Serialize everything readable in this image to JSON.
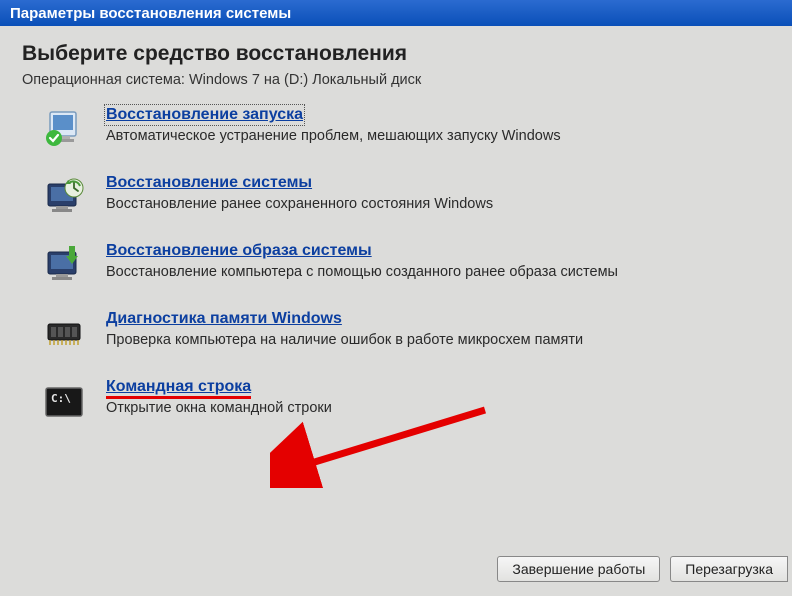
{
  "titlebar": "Параметры восстановления системы",
  "heading": "Выберите средство восстановления",
  "subheading": "Операционная система: Windows 7 на (D:) Локальный диск",
  "options": [
    {
      "link": "Восстановление запуска",
      "desc": "Автоматическое устранение проблем, мешающих запуску Windows"
    },
    {
      "link": "Восстановление системы",
      "desc": "Восстановление ранее сохраненного состояния Windows"
    },
    {
      "link": "Восстановление образа системы",
      "desc": "Восстановление компьютера с помощью  созданного ранее образа системы"
    },
    {
      "link": "Диагностика памяти Windows",
      "desc": "Проверка компьютера на наличие ошибок в работе микросхем памяти"
    },
    {
      "link": "Командная строка",
      "desc": "Открытие окна командной строки"
    }
  ],
  "buttons": {
    "shutdown": "Завершение работы",
    "restart": "Перезагрузка"
  }
}
